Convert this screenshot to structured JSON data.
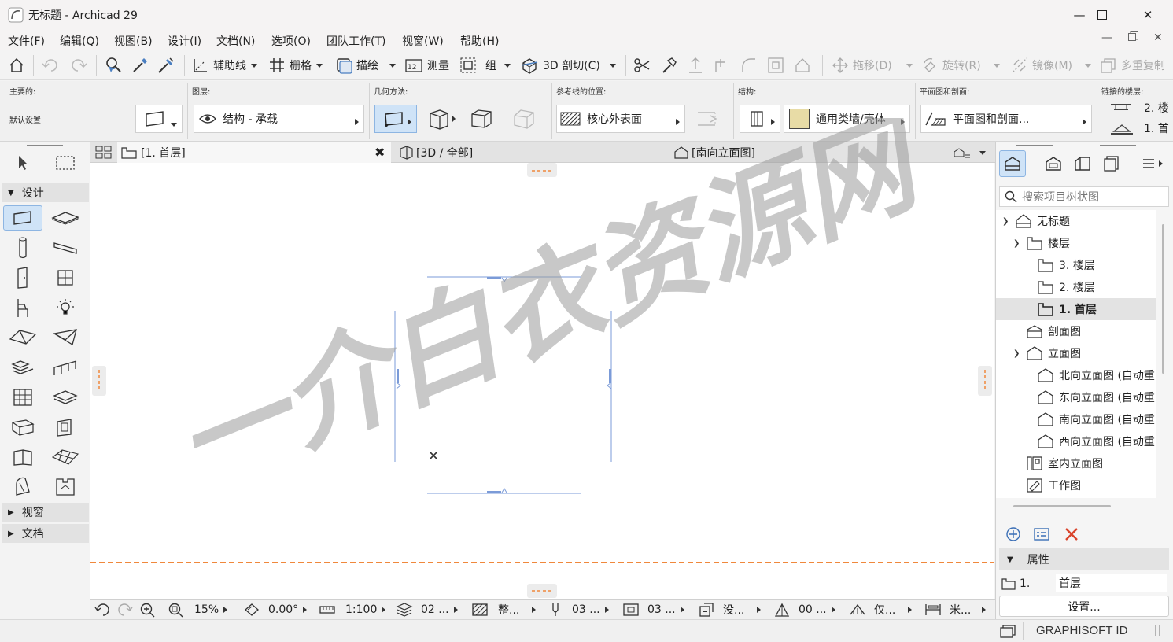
{
  "window": {
    "title": "无标题 - Archicad 29"
  },
  "menu": [
    "文件(F)",
    "编辑(Q)",
    "视图(B)",
    "设计(I)",
    "文档(N)",
    "选项(O)",
    "团队工作(T)",
    "视窗(W)",
    "帮助(H)"
  ],
  "toolbar": {
    "guide": "辅助线",
    "grid": "栅格",
    "trace": "描绘",
    "measure": "测量",
    "group": "组",
    "cutaway_3d": "3D 剖切(C)",
    "drag": "拖移(D)",
    "rotate": "旋转(R)",
    "mirror": "镜像(M)",
    "multiply": "多重复制"
  },
  "infobox": {
    "main_caption": "主要的:",
    "main_value": "默认设置",
    "layer_caption": "图层:",
    "layer_value": "结构 - 承载",
    "geometry_caption": "几何方法:",
    "refline_caption": "参考线的位置:",
    "refline_value": "核心外表面",
    "structure_caption": "结构:",
    "structure_value": "通用类墙/壳体",
    "planview_caption": "平面图和剖面:",
    "planview_value": "平面图和剖面...",
    "linked_caption": "链接的楼层:",
    "linked_top": "2. 楼",
    "linked_bottom": "1. 首"
  },
  "toolbox": {
    "sections": {
      "design": "设计",
      "viewpoint": "视窗",
      "document": "文档"
    },
    "tools": [
      "arrow",
      "marquee",
      "wall",
      "slab",
      "column",
      "beam",
      "door",
      "window",
      "object",
      "lamp",
      "roof",
      "shell",
      "stair",
      "railing",
      "curtain-wall",
      "mesh",
      "skylight",
      "opening",
      "zone",
      "morph",
      "fill",
      "elevation"
    ]
  },
  "tabs": [
    {
      "label": "[1. 首层]"
    },
    {
      "label": "[3D / 全部]"
    },
    {
      "label": "[南向立面图]"
    }
  ],
  "statusbar": {
    "zoom": "15%",
    "angle": "0.00°",
    "scale": "1:100",
    "layer_combo": "02 ...",
    "structure_display": "整...",
    "pen_set": "03 ...",
    "model_view": "03 ...",
    "override": "没...",
    "renovation": "00 ...",
    "partial": "仅...",
    "dimension": "米..."
  },
  "navigator": {
    "search_placeholder": "搜索项目树状图",
    "tree": [
      {
        "label": "无标题",
        "level": 0,
        "expanded": true,
        "icon": "project-icon"
      },
      {
        "label": "楼层",
        "level": 1,
        "expanded": true,
        "icon": "story-icon"
      },
      {
        "label": "3. 楼层",
        "level": 2,
        "icon": "story-icon"
      },
      {
        "label": "2. 楼层",
        "level": 2,
        "icon": "story-icon"
      },
      {
        "label": "1. 首层",
        "level": 2,
        "icon": "story-icon",
        "selected": true
      },
      {
        "label": "剖面图",
        "level": 1,
        "icon": "section-icon"
      },
      {
        "label": "立面图",
        "level": 1,
        "expanded": true,
        "icon": "elevation-icon"
      },
      {
        "label": "北向立面图 (自动重",
        "level": 2,
        "icon": "elevation-icon"
      },
      {
        "label": "东向立面图 (自动重",
        "level": 2,
        "icon": "elevation-icon"
      },
      {
        "label": "南向立面图 (自动重",
        "level": 2,
        "icon": "elevation-icon"
      },
      {
        "label": "西向立面图 (自动重",
        "level": 2,
        "icon": "elevation-icon"
      },
      {
        "label": "室内立面图",
        "level": 1,
        "icon": "interior-elevation-icon"
      },
      {
        "label": "工作图",
        "level": 1,
        "icon": "worksheet-icon"
      }
    ],
    "properties_header": "属性",
    "properties_id": "1.",
    "properties_name": "首层",
    "settings_button": "设置..."
  },
  "footer": {
    "brand": "GRAPHISOFT ID"
  },
  "watermark": "一介白衣资源网"
}
